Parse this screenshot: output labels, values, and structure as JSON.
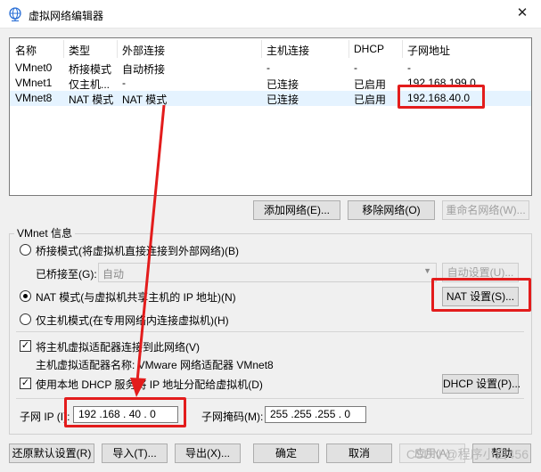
{
  "window": {
    "title": "虚拟网络编辑器",
    "close": "✕"
  },
  "table": {
    "headers": [
      "名称",
      "类型",
      "外部连接",
      "主机连接",
      "DHCP",
      "子网地址"
    ],
    "rows": [
      [
        "VMnet0",
        "桥接模式",
        "自动桥接",
        "-",
        "-",
        "-"
      ],
      [
        "VMnet1",
        "仅主机...",
        "-",
        "已连接",
        "已启用",
        "192.168.199.0"
      ],
      [
        "VMnet8",
        "NAT 模式",
        "NAT 模式",
        "已连接",
        "已启用",
        "192.168.40.0"
      ]
    ]
  },
  "table_buttons": {
    "add": "添加网络(E)...",
    "remove": "移除网络(O)",
    "rename": "重命名网络(W)..."
  },
  "vmnet_info": {
    "group_label": "VMnet 信息",
    "bridge_option": "桥接模式(将虚拟机直接连接到外部网络)(B)",
    "bridged_to_label": "已桥接至(G):",
    "bridged_to_value": "自动",
    "auto_settings": "自动设置(U)...",
    "nat_option": "NAT 模式(与虚拟机共享主机的 IP 地址)(N)",
    "nat_settings": "NAT 设置(S)...",
    "host_only_option": "仅主机模式(在专用网络内连接虚拟机)(H)",
    "connect_adapter": "将主机虚拟适配器连接到此网络(V)",
    "adapter_name": "主机虚拟适配器名称: VMware 网络适配器 VMnet8",
    "use_dhcp": "使用本地 DHCP 服务将 IP 地址分配给虚拟机(D)",
    "dhcp_settings": "DHCP 设置(P)...",
    "subnet_ip_label": "子网 IP (I):",
    "subnet_ip": "192 .168 . 40 . 0",
    "subnet_mask_label": "子网掩码(M):",
    "subnet_mask": "255 .255 .255 . 0",
    "selected_mode": "nat"
  },
  "footer_buttons": {
    "restore": "还原默认设置(R)",
    "import": "导入(T)...",
    "export": "导出(X)...",
    "ok": "确定",
    "cancel": "取消",
    "apply": "应用(A)",
    "help": "帮助"
  },
  "watermark": "CSDN @程序小白456",
  "colors": {
    "annotation": "#e31c1c",
    "selected_row": "#e5f3ff"
  }
}
